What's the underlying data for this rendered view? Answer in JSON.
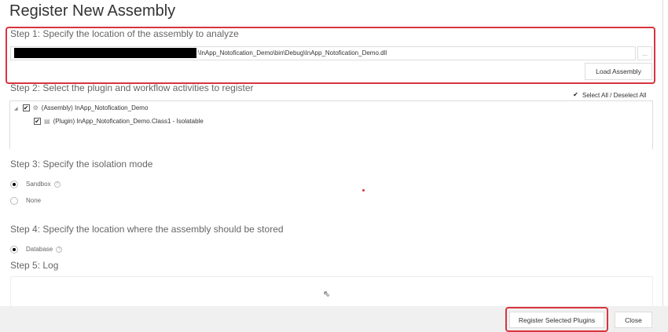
{
  "title": "Register New Assembly",
  "step1": {
    "label": "Step 1: Specify the location of the assembly to analyze",
    "path": "\\InApp_Notofication_Demo\\bin\\Debug\\InApp_Notofication_Demo.dll",
    "browse": "...",
    "load": "Load Assembly"
  },
  "step2": {
    "label": "Step 2: Select the plugin and workflow activities to register",
    "select_all": "Select All / Deselect All",
    "assembly": "(Assembly) InApp_Notofication_Demo",
    "plugin": "(Plugin) InApp_Notofication_Demo.Class1 - Isolatable"
  },
  "step3": {
    "label": "Step 3: Specify the isolation mode",
    "sandbox": "Sandbox",
    "none": "None"
  },
  "step4": {
    "label": "Step 4: Specify the location where the assembly should be stored",
    "database": "Database"
  },
  "step5": {
    "label": "Step 5: Log"
  },
  "footer": {
    "register": "Register Selected Plugins",
    "close": "Close"
  },
  "help": "?",
  "check": "✔"
}
